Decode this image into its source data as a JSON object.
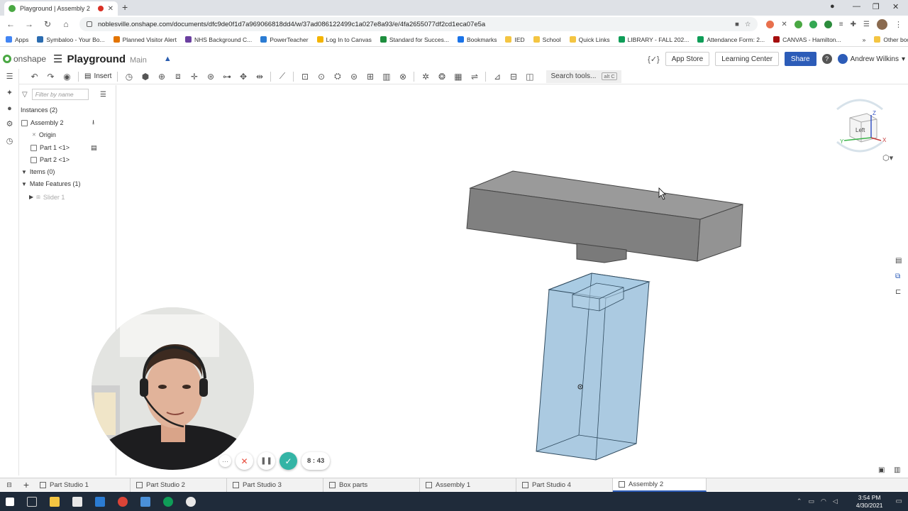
{
  "browser": {
    "tab_title": "Playground | Assembly 2",
    "new_tab": "+",
    "url": "noblesville.onshape.com/documents/dfc9de0f1d7a969066818dd4/w/37ad086122499c1a027e8a93/e/4fa2655077df2cd1eca07e5a",
    "bookmarks": [
      "Apps",
      "Symbaloo - Your Bo...",
      "Planned Visitor Alert",
      "NHS Background C...",
      "PowerTeacher",
      "Log In to Canvas",
      "Standard for Succes...",
      "Bookmarks",
      "IED",
      "School",
      "Quick Links",
      "LIBRARY - FALL 202...",
      "Attendance Form: 2...",
      "CANVAS - Hamilton...",
      "Other bookmarks"
    ]
  },
  "header": {
    "logo": "onshape",
    "doc_name": "Playground",
    "workspace": "Main",
    "app_store": "App Store",
    "learning_center": "Learning Center",
    "share": "Share",
    "help": "?",
    "user": "Andrew Wilkins",
    "braces": "{✓}"
  },
  "toolbar": {
    "insert": "Insert",
    "search_label": "Search tools...",
    "search_shortcut": "alt C"
  },
  "instances": {
    "filter_placeholder": "Filter by name",
    "title": "Instances (2)",
    "assembly": "Assembly 2",
    "origin": "Origin",
    "part1": "Part 1 <1>",
    "part2": "Part 2 <1>",
    "items": "Items (0)",
    "mate_features": "Mate Features (1)",
    "slider": "Slider 1"
  },
  "viewcube": {
    "face": "Left",
    "axis_z": "Z",
    "axis_y": "Y",
    "axis_x": "X"
  },
  "bottom_tabs": [
    "Part Studio 1",
    "Part Studio 2",
    "Part Studio 3",
    "Box parts",
    "Assembly 1",
    "Part Studio 4",
    "Assembly 2"
  ],
  "bottom_add": "+",
  "recorder": {
    "time": "8 : 43",
    "more": "···",
    "cancel": "✕",
    "pause": "❚❚",
    "done": "✓"
  },
  "taskbar": {
    "time": "3:54 PM",
    "date": "4/30/2021"
  },
  "colors": {
    "accent": "#2c5cb8",
    "onshape_green": "#4aa843",
    "part_gray": "#8a8a8a",
    "part_blue": "#8fb8d8"
  }
}
